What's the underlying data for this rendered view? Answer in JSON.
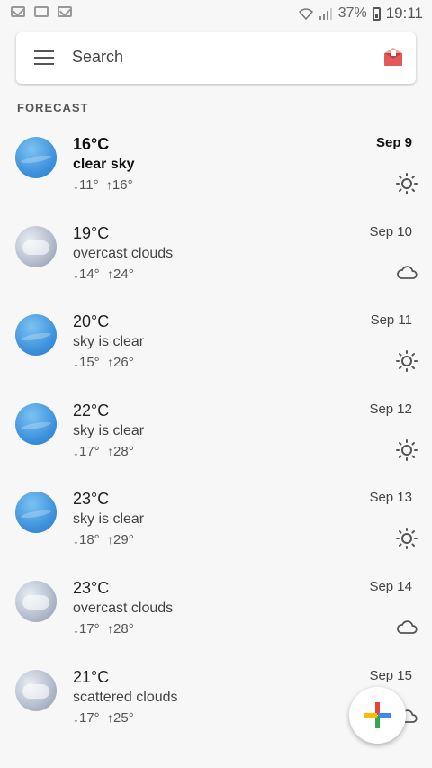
{
  "status_bar": {
    "battery_percent": "37%",
    "time": "19:11"
  },
  "search": {
    "label": "Search"
  },
  "section_title": "FORECAST",
  "forecast": [
    {
      "temp": "16°C",
      "desc": "clear sky",
      "min": "11°",
      "max": "16°",
      "date": "Sep 9",
      "icon": "sun-icon",
      "thumb": "clear",
      "active": true
    },
    {
      "temp": "19°C",
      "desc": "overcast clouds",
      "min": "14°",
      "max": "24°",
      "date": "Sep 10",
      "icon": "cloud-icon",
      "thumb": "cloudy"
    },
    {
      "temp": "20°C",
      "desc": "sky is clear",
      "min": "15°",
      "max": "26°",
      "date": "Sep 11",
      "icon": "sun-icon",
      "thumb": "clear"
    },
    {
      "temp": "22°C",
      "desc": "sky is clear",
      "min": "17°",
      "max": "28°",
      "date": "Sep 12",
      "icon": "sun-icon",
      "thumb": "clear"
    },
    {
      "temp": "23°C",
      "desc": "sky is clear",
      "min": "18°",
      "max": "29°",
      "date": "Sep 13",
      "icon": "sun-icon",
      "thumb": "clear"
    },
    {
      "temp": "23°C",
      "desc": "overcast clouds",
      "min": "17°",
      "max": "28°",
      "date": "Sep 14",
      "icon": "cloud-icon",
      "thumb": "cloudy"
    },
    {
      "temp": "21°C",
      "desc": "scattered clouds",
      "min": "17°",
      "max": "25°",
      "date": "Sep 15",
      "icon": "cloud-icon",
      "thumb": "cloudy"
    }
  ],
  "fab": {
    "icon": "plus-icon"
  }
}
